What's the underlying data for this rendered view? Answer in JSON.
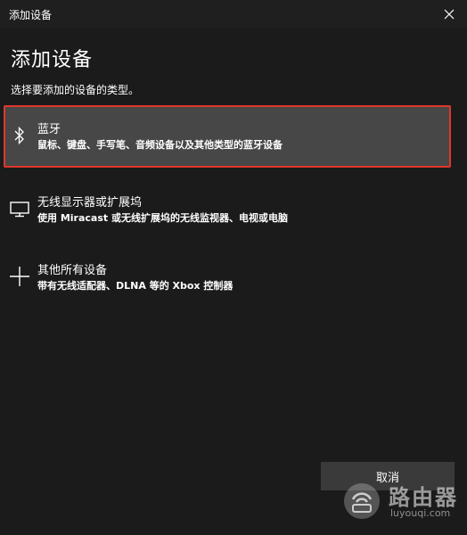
{
  "window": {
    "title": "添加设备"
  },
  "page": {
    "heading": "添加设备",
    "subtitle": "选择要添加的设备的类型。"
  },
  "options": [
    {
      "name": "蓝牙",
      "desc": "鼠标、键盘、手写笔、音频设备以及其他类型的蓝牙设备",
      "icon": "bluetooth-icon",
      "selected": true
    },
    {
      "name": "无线显示器或扩展坞",
      "desc": "使用 Miracast 或无线扩展坞的无线监视器、电视或电脑",
      "icon": "monitor-icon",
      "selected": false
    },
    {
      "name": "其他所有设备",
      "desc": "带有无线适配器、DLNA 等的 Xbox 控制器",
      "icon": "plus-icon",
      "selected": false
    }
  ],
  "footer": {
    "cancel_label": "取消"
  },
  "watermark": {
    "brand": "路由器",
    "url": "luyouqi.com"
  },
  "colors": {
    "background": "#1b1b1b",
    "titlebar": "#1f1f1f",
    "selected_bg": "#474747",
    "selected_border": "#e0362a",
    "button_bg": "#3a3a3a",
    "text": "#ffffff"
  }
}
